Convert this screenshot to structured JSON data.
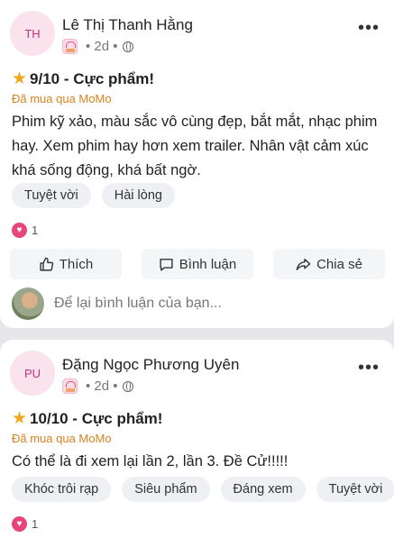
{
  "reviews": [
    {
      "initials": "TH",
      "author": "Lê Thị Thanh Hằng",
      "time": "• 2d •",
      "rating": "9/10 - Cực phẩm!",
      "purchase": "Đã mua qua MoMo",
      "text": "Phim kỹ xảo, màu sắc vô cùng đẹp, bắt mắt, nhạc phim hay. Xem phim hay hơn xem trailer. Nhân vật cảm xúc khá sống động, khá bất ngờ.",
      "tags": [
        "Tuyệt vời",
        "Hài lòng"
      ],
      "likes": "1"
    },
    {
      "initials": "PU",
      "author": "Đặng Ngọc Phương Uyên",
      "time": "• 2d •",
      "rating": "10/10 - Cực phẩm!",
      "purchase": "Đã mua qua MoMo",
      "text": "Có thể là đi xem lại lần 2, lần 3. Đề Cử!!!!!",
      "tags": [
        "Khóc trôi rạp",
        "Siêu phẩm",
        "Đáng xem",
        "Tuyệt vời"
      ],
      "likes": "1"
    }
  ],
  "actions": {
    "like": "Thích",
    "comment": "Bình luận",
    "share": "Chia sẻ"
  },
  "comment_placeholder": "Để lại bình luận của bạn...",
  "icons": [
    "more-options-icon",
    "star-icon",
    "globe-icon",
    "heart-reaction-icon",
    "thumbs-up-icon",
    "comment-icon",
    "share-icon"
  ],
  "colors": {
    "accent": "#e8467a",
    "purchase": "#d9821e",
    "star": "#f2a81d",
    "background": "#e6e6eb"
  }
}
